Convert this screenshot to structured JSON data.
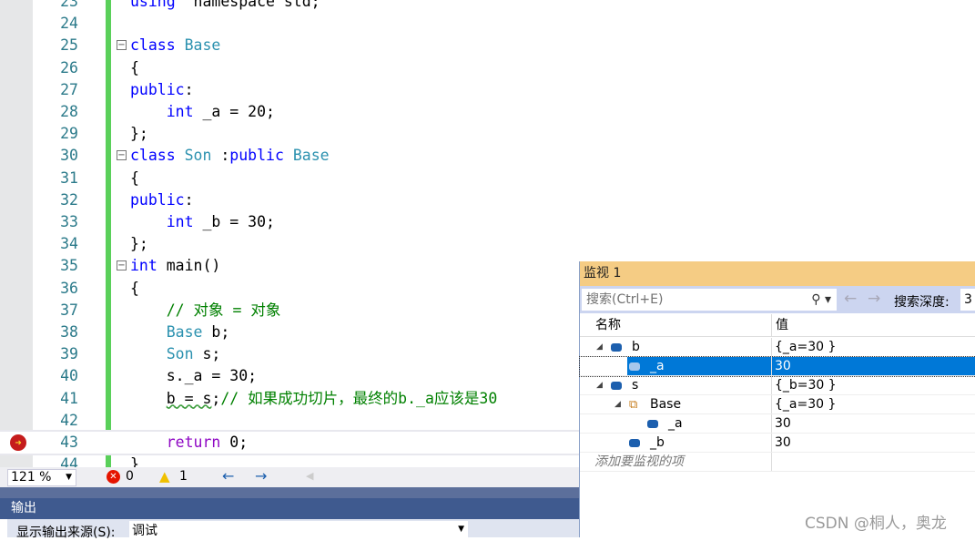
{
  "editor": {
    "lines": [
      {
        "n": "23",
        "parts": [
          [
            "kw",
            "using"
          ],
          [
            "",
            "  namespace std;"
          ]
        ]
      },
      {
        "n": "24",
        "parts": []
      },
      {
        "n": "25",
        "fold": true,
        "parts": [
          [
            "kw",
            "class"
          ],
          [
            "",
            " "
          ],
          [
            "ty",
            "Base"
          ]
        ]
      },
      {
        "n": "26",
        "parts": [
          [
            "",
            "{"
          ]
        ]
      },
      {
        "n": "27",
        "parts": [
          [
            "kw",
            "public"
          ],
          [
            "",
            ":"
          ]
        ]
      },
      {
        "n": "28",
        "parts": [
          [
            "",
            "    "
          ],
          [
            "kw",
            "int"
          ],
          [
            "",
            " _a = 20;"
          ]
        ]
      },
      {
        "n": "29",
        "parts": [
          [
            "",
            "};"
          ]
        ]
      },
      {
        "n": "30",
        "fold": true,
        "parts": [
          [
            "kw",
            "class"
          ],
          [
            "",
            " "
          ],
          [
            "ty",
            "Son"
          ],
          [
            "",
            " :"
          ],
          [
            "kw",
            "public"
          ],
          [
            "",
            " "
          ],
          [
            "ty",
            "Base"
          ]
        ]
      },
      {
        "n": "31",
        "parts": [
          [
            "",
            "{"
          ]
        ]
      },
      {
        "n": "32",
        "parts": [
          [
            "kw",
            "public"
          ],
          [
            "",
            ":"
          ]
        ]
      },
      {
        "n": "33",
        "parts": [
          [
            "",
            "    "
          ],
          [
            "kw",
            "int"
          ],
          [
            "",
            " _b = 30;"
          ]
        ]
      },
      {
        "n": "34",
        "parts": [
          [
            "",
            "};"
          ]
        ]
      },
      {
        "n": "35",
        "fold": true,
        "parts": [
          [
            "kw",
            "int"
          ],
          [
            "",
            " main()"
          ]
        ]
      },
      {
        "n": "36",
        "parts": [
          [
            "",
            "{"
          ]
        ]
      },
      {
        "n": "37",
        "parts": [
          [
            "",
            "    "
          ],
          [
            "cm",
            "// 对象 = 对象"
          ]
        ]
      },
      {
        "n": "38",
        "parts": [
          [
            "",
            "    "
          ],
          [
            "ty",
            "Base"
          ],
          [
            "",
            " b;"
          ]
        ]
      },
      {
        "n": "39",
        "parts": [
          [
            "",
            "    "
          ],
          [
            "ty",
            "Son"
          ],
          [
            "",
            " s;"
          ]
        ]
      },
      {
        "n": "40",
        "parts": [
          [
            "",
            "    s._a = 30;"
          ]
        ]
      },
      {
        "n": "41",
        "parts": [
          [
            "",
            "    "
          ],
          [
            "squig",
            "b = s"
          ],
          [
            "",
            ";"
          ],
          [
            "cm",
            "// 如果成功切片，最终的b._a应该是30"
          ]
        ]
      },
      {
        "n": "42",
        "parts": []
      },
      {
        "n": "43",
        "current": true,
        "parts": [
          [
            "",
            "    "
          ],
          [
            "pu",
            "return"
          ],
          [
            "",
            " 0;"
          ]
        ]
      },
      {
        "n": "44",
        "parts": [
          [
            "",
            "}"
          ]
        ]
      }
    ]
  },
  "status": {
    "zoom": "121 %",
    "errors": "0",
    "warnings": "1"
  },
  "output": {
    "title": "输出",
    "source_label": "显示输出来源(S):",
    "source_value": "调试"
  },
  "watch": {
    "title": "监视 1",
    "search_placeholder": "搜索(Ctrl+E)",
    "depth_label": "搜索深度:",
    "depth_value": "3",
    "col_name": "名称",
    "col_value": "值",
    "rows": [
      {
        "name": "b",
        "value": "{_a=30 }",
        "level": 0,
        "expand": true,
        "icon": "field"
      },
      {
        "name": "_a",
        "value": "30",
        "level": 1,
        "selected": true,
        "icon": "field"
      },
      {
        "name": "s",
        "value": "{_b=30 }",
        "level": 0,
        "expand": true,
        "icon": "field"
      },
      {
        "name": "Base",
        "value": "{_a=30 }",
        "level": 1,
        "expand": true,
        "icon": "base-class"
      },
      {
        "name": "_a",
        "value": "30",
        "level": 2,
        "icon": "field"
      },
      {
        "name": "_b",
        "value": "30",
        "level": 1,
        "icon": "field"
      }
    ],
    "add_item": "添加要监视的项"
  },
  "watermark": "CSDN @桐人，奥龙",
  "colors": {
    "keyword": "#0000ff",
    "type": "#2b91af",
    "comment": "#008000",
    "control": "#8f08c4",
    "selection": "#0078d7",
    "watch_title": "#f5cc84"
  }
}
